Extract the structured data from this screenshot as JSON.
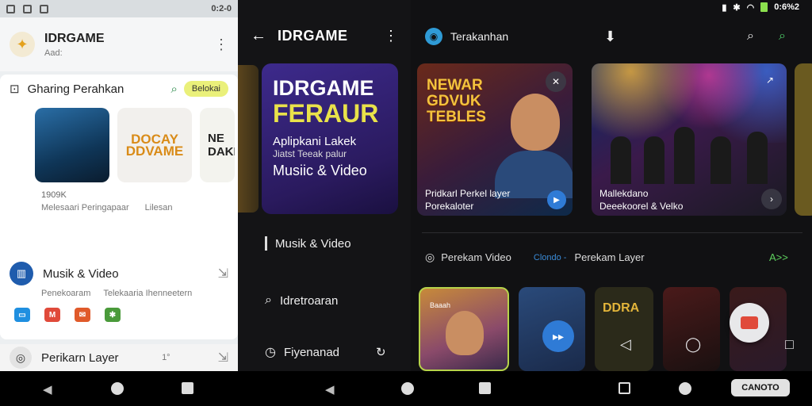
{
  "left": {
    "status_right": "0:2-0",
    "app_title": "IDRGAME",
    "app_sub": "Aad:",
    "section_title": "Gharing Perahkan",
    "section_pill": "Belokai",
    "thumb2_text": "DOCAY DDVAME",
    "thumb3_text": "NE DAKN",
    "meta1": "1909K",
    "meta2_a": "Melesaari Peringapaar",
    "meta2_b": "Lilesan",
    "list_item1": "Musik & Video",
    "list_meta_a": "Penekoaram",
    "list_meta_b": "Telekaaria Ihenneetern",
    "list_item2": "Perikarn Layer",
    "list_item2_meta": "1°"
  },
  "middle": {
    "title": "IDRGAME",
    "hero_l1": "IDRGAME",
    "hero_l2": "FERAUR",
    "hero_l3": "Aplipkani Lakek",
    "hero_l4": "Jiatst Teeak palur",
    "hero_l5": "Musiic & Video",
    "drawer_item1": "Musik & Video",
    "drawer_item2": "Idretroaran",
    "drawer_item3": "Fiyenanad"
  },
  "right": {
    "status_time": "0:6%2",
    "bar_title": "Terakanhan",
    "card1_title": "NEWAR GDVUK TEBLES",
    "card1_cap1": "Pridkarl Perkel layer",
    "card1_cap2": "Porekaloter",
    "card2_cap1": "Mallekdano",
    "card2_cap2": "Deeekoorel & Velko",
    "tab1": "Perekam Video",
    "tab_mid": "Clondo -",
    "tab2": "Perekam Layer",
    "tab_go": "A>>",
    "tile1_tag": "Baaah",
    "tile3_logo": "DDRA"
  },
  "nav": {
    "pill": "CANOTO"
  },
  "icons": {
    "back": "arrow-left-icon",
    "kebab": "more-vertical-icon",
    "search": "search-icon",
    "download": "download-icon",
    "play": "play-icon"
  },
  "colors": {
    "accent_yellow": "#e9e24a",
    "accent_green": "#4fce6a",
    "accent_blue": "#2f7bd6",
    "dark_bg": "#111113",
    "light_bg": "#eceff1"
  }
}
